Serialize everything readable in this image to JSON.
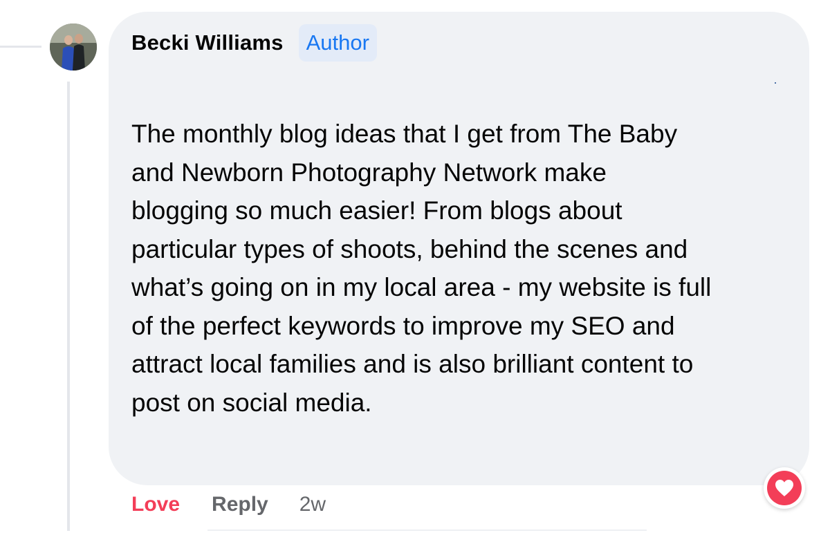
{
  "comment": {
    "author": "Becki Williams",
    "badge": "Author",
    "text": "The monthly blog ideas that I get from The Baby\nand Newborn Photography Network make\nblogging so much easier! From blogs about\nparticular types of shoots, behind the scenes and\nwhat’s going on in my local area - my website is full\nof the perfect keywords to improve my SEO and\nattract local families and is also brilliant content to\npost on social media."
  },
  "actions": {
    "love_label": "Love",
    "reply_label": "Reply",
    "timestamp": "2w"
  },
  "reaction": {
    "icon": "heart-icon",
    "color": "#f33e58"
  },
  "colors": {
    "bubble": "#f0f2f5",
    "badge_bg": "#e3ebf8",
    "badge_text": "#1877f2",
    "love": "#f33e58",
    "muted": "#65676b"
  }
}
